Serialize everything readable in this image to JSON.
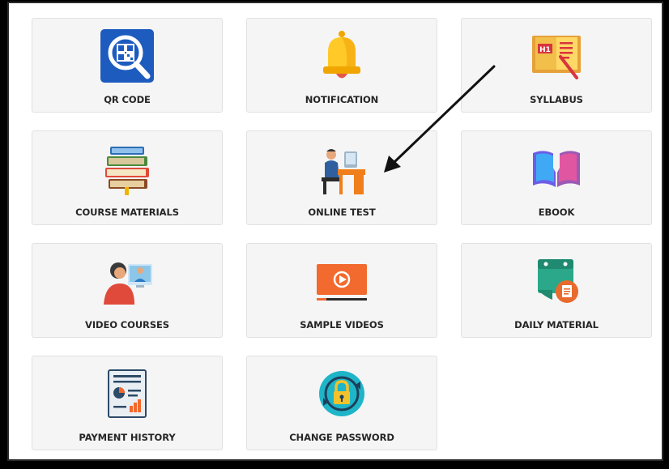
{
  "menu": {
    "items": [
      {
        "label": "QR CODE",
        "icon": "qr-code-icon"
      },
      {
        "label": "NOTIFICATION",
        "icon": "bell-icon"
      },
      {
        "label": "SYLLABUS",
        "icon": "syllabus-book-icon"
      },
      {
        "label": "COURSE MATERIALS",
        "icon": "books-stack-icon"
      },
      {
        "label": "ONLINE TEST",
        "icon": "person-at-desk-icon"
      },
      {
        "label": "EBOOK",
        "icon": "open-book-icon"
      },
      {
        "label": "VIDEO COURSES",
        "icon": "video-call-icon"
      },
      {
        "label": "SAMPLE VIDEOS",
        "icon": "video-player-icon"
      },
      {
        "label": "DAILY MATERIAL",
        "icon": "calendar-document-icon"
      },
      {
        "label": "PAYMENT HISTORY",
        "icon": "report-chart-icon"
      },
      {
        "label": "CHANGE PASSWORD",
        "icon": "padlock-refresh-icon"
      }
    ]
  },
  "annotation": {
    "points_to": "ONLINE TEST",
    "icon": "arrow-icon"
  },
  "colors": {
    "tile_background": "#f5f5f5",
    "tile_border": "#e1e1e1",
    "label_text": "#262626",
    "frame": "#000000"
  }
}
